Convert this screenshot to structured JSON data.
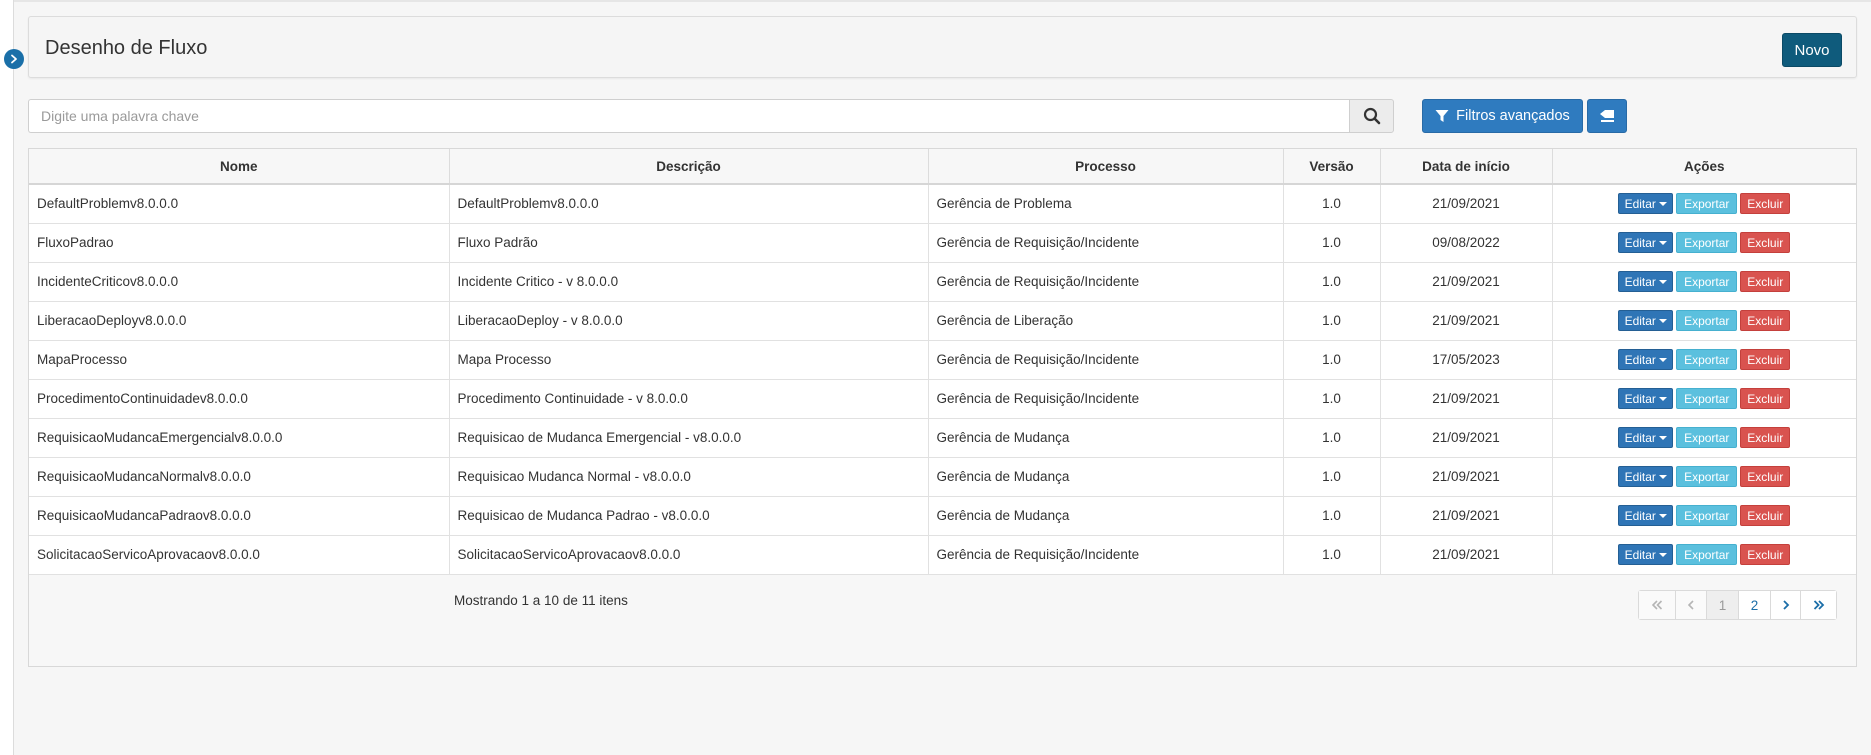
{
  "header": {
    "title": "Desenho de Fluxo",
    "new_button": "Novo"
  },
  "search": {
    "placeholder": "Digite uma palavra chave",
    "advanced_filters_label": "Filtros avançados"
  },
  "table": {
    "columns": [
      "Nome",
      "Descrição",
      "Processo",
      "Versão",
      "Data de início",
      "Ações"
    ],
    "actions": {
      "edit": "Editar",
      "export": "Exportar",
      "delete": "Excluir"
    },
    "rows": [
      {
        "nome": "DefaultProblemv8.0.0.0",
        "descricao": "DefaultProblemv8.0.0.0",
        "processo": "Gerência de Problema",
        "versao": "1.0",
        "data": "21/09/2021"
      },
      {
        "nome": "FluxoPadrao",
        "descricao": "Fluxo Padrão",
        "processo": "Gerência de Requisição/Incidente",
        "versao": "1.0",
        "data": "09/08/2022"
      },
      {
        "nome": "IncidenteCriticov8.0.0.0",
        "descricao": "Incidente Critico - v 8.0.0.0",
        "processo": "Gerência de Requisição/Incidente",
        "versao": "1.0",
        "data": "21/09/2021"
      },
      {
        "nome": "LiberacaoDeployv8.0.0.0",
        "descricao": "LiberacaoDeploy - v 8.0.0.0",
        "processo": "Gerência de Liberação",
        "versao": "1.0",
        "data": "21/09/2021"
      },
      {
        "nome": "MapaProcesso",
        "descricao": "Mapa Processo",
        "processo": "Gerência de Requisição/Incidente",
        "versao": "1.0",
        "data": "17/05/2023"
      },
      {
        "nome": "ProcedimentoContinuidadev8.0.0.0",
        "descricao": "Procedimento Continuidade - v 8.0.0.0",
        "processo": "Gerência de Requisição/Incidente",
        "versao": "1.0",
        "data": "21/09/2021"
      },
      {
        "nome": "RequisicaoMudancaEmergencialv8.0.0.0",
        "descricao": "Requisicao de Mudanca Emergencial - v8.0.0.0",
        "processo": "Gerência de Mudança",
        "versao": "1.0",
        "data": "21/09/2021"
      },
      {
        "nome": "RequisicaoMudancaNormalv8.0.0.0",
        "descricao": "Requisicao Mudanca Normal - v8.0.0.0",
        "processo": "Gerência de Mudança",
        "versao": "1.0",
        "data": "21/09/2021"
      },
      {
        "nome": "RequisicaoMudancaPadraov8.0.0.0",
        "descricao": "Requisicao de Mudanca Padrao - v8.0.0.0",
        "processo": "Gerência de Mudança",
        "versao": "1.0",
        "data": "21/09/2021"
      },
      {
        "nome": "SolicitacaoServicoAprovacaov8.0.0.0",
        "descricao": "SolicitacaoServicoAprovacaov8.0.0.0",
        "processo": "Gerência de Requisição/Incidente",
        "versao": "1.0",
        "data": "21/09/2021"
      }
    ]
  },
  "footer": {
    "showing_text": "Mostrando 1 a 10 de 11 itens"
  },
  "pagination": {
    "pages": [
      "1",
      "2"
    ],
    "current_page": "1",
    "first_icon": "double-chevron-left-icon",
    "prev_icon": "chevron-left-icon",
    "next_icon": "chevron-right-icon",
    "last_icon": "double-chevron-right-icon"
  },
  "colors": {
    "primary": "#0f5b7c",
    "filter_button": "#2f7bbf",
    "edit": "#2f75b6",
    "export": "#5bc0de",
    "delete": "#d9534f"
  },
  "icons": {
    "sidebar_toggle": "chevron-right-icon",
    "search": "search-icon",
    "filter": "filter-icon",
    "clear": "eraser-icon"
  }
}
